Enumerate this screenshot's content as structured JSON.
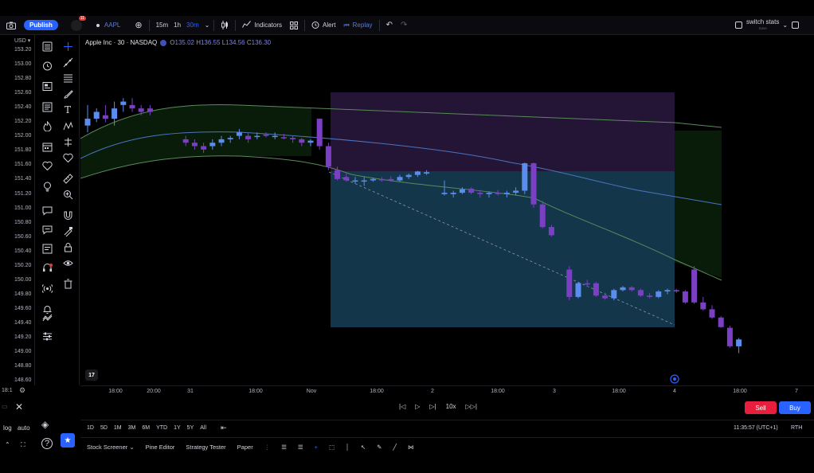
{
  "toolbar": {
    "publish_label": "Publish",
    "notif_count": "11",
    "symbol": "AAPL",
    "timeframes": [
      "15m",
      "1h",
      "30m"
    ],
    "indicators_label": "Indicators",
    "alert_label": "Alert",
    "replay_label": "Replay",
    "layout_name": "switch stats",
    "layout_sub": "Save"
  },
  "legend": {
    "title": "Apple Inc · 30 · NASDAQ",
    "o_label": "O",
    "o": "135.02",
    "h_label": "H",
    "h": "136.55",
    "l_label": "L",
    "l": "134.56",
    "c_label": "C",
    "c": "136.30"
  },
  "price_scale": {
    "currency": "USD",
    "labels": [
      "153.20",
      "153.00",
      "152.80",
      "152.60",
      "152.40",
      "152.20",
      "152.00",
      "151.80",
      "151.60",
      "151.40",
      "151.20",
      "151.00",
      "150.80",
      "150.60",
      "150.40",
      "150.20",
      "150.00",
      "149.80",
      "149.60",
      "149.40",
      "149.20",
      "149.00",
      "148.80",
      "148.60"
    ]
  },
  "time_axis": {
    "labels": [
      "18:00",
      "20:00",
      "31",
      "18:00",
      "Nov",
      "18:00",
      "2",
      "18:00",
      "3",
      "18:00",
      "4",
      "18:00",
      "7"
    ]
  },
  "replay": {
    "speed": "10x",
    "sell_label": "Sell",
    "buy_label": "Buy"
  },
  "range_bar": {
    "ranges": [
      "1D",
      "5D",
      "1M",
      "3M",
      "6M",
      "YTD",
      "1Y",
      "5Y",
      "All"
    ],
    "clock": "11:35:57 (UTC+1)",
    "session": "RTH",
    "log_label": "log",
    "auto_label": "auto",
    "corner_label": "18:1"
  },
  "bottom_panel": {
    "tabs": [
      "Stock Screener",
      "Pine Editor",
      "Strategy Tester",
      "Paper"
    ]
  },
  "colors": {
    "bull": "#5b8def",
    "bear": "#7b3fc4",
    "accent": "#2962ff",
    "sell": "#e91e3c"
  },
  "chart_data": {
    "type": "candlestick",
    "title": "Apple Inc · 30 · NASDAQ",
    "ylim": [
      148.5,
      153.3
    ],
    "candles": [
      {
        "x": 0,
        "o": 152.1,
        "h": 152.4,
        "l": 152.0,
        "c": 152.2
      },
      {
        "x": 1,
        "o": 152.2,
        "h": 152.35,
        "l": 152.15,
        "c": 152.3
      },
      {
        "x": 2,
        "o": 152.25,
        "h": 152.4,
        "l": 152.15,
        "c": 152.2
      },
      {
        "x": 3,
        "o": 152.2,
        "h": 152.45,
        "l": 152.1,
        "c": 152.35
      },
      {
        "x": 4,
        "o": 152.4,
        "h": 152.5,
        "l": 152.3,
        "c": 152.45
      },
      {
        "x": 5,
        "o": 152.4,
        "h": 152.5,
        "l": 152.3,
        "c": 152.35
      },
      {
        "x": 6,
        "o": 152.35,
        "h": 152.4,
        "l": 152.25,
        "c": 152.3
      },
      {
        "x": 7,
        "o": 152.35,
        "h": 152.4,
        "l": 152.25,
        "c": 152.3
      },
      {
        "x": 11,
        "o": 151.9,
        "h": 151.95,
        "l": 151.8,
        "c": 151.85
      },
      {
        "x": 12,
        "o": 151.85,
        "h": 151.9,
        "l": 151.75,
        "c": 151.8
      },
      {
        "x": 13,
        "o": 151.8,
        "h": 151.85,
        "l": 151.7,
        "c": 151.75
      },
      {
        "x": 14,
        "o": 151.8,
        "h": 151.9,
        "l": 151.75,
        "c": 151.85
      },
      {
        "x": 15,
        "o": 151.85,
        "h": 151.95,
        "l": 151.8,
        "c": 151.9
      },
      {
        "x": 16,
        "o": 151.9,
        "h": 151.95,
        "l": 151.85,
        "c": 151.92
      },
      {
        "x": 17,
        "o": 151.95,
        "h": 152.05,
        "l": 151.9,
        "c": 152.0
      },
      {
        "x": 18,
        "o": 151.95,
        "h": 152.0,
        "l": 151.85,
        "c": 151.9
      },
      {
        "x": 19,
        "o": 151.95,
        "h": 152.0,
        "l": 151.9,
        "c": 151.95
      },
      {
        "x": 20,
        "o": 151.97,
        "h": 152.0,
        "l": 151.93,
        "c": 151.95
      },
      {
        "x": 21,
        "o": 151.95,
        "h": 152.0,
        "l": 151.9,
        "c": 151.95
      },
      {
        "x": 22,
        "o": 151.93,
        "h": 151.98,
        "l": 151.9,
        "c": 151.92
      },
      {
        "x": 23,
        "o": 151.92,
        "h": 151.95,
        "l": 151.85,
        "c": 151.9
      },
      {
        "x": 24,
        "o": 151.9,
        "h": 151.92,
        "l": 151.8,
        "c": 151.85
      },
      {
        "x": 25,
        "o": 151.85,
        "h": 151.9,
        "l": 151.8,
        "c": 151.88
      },
      {
        "x": 26,
        "o": 152.2,
        "h": 152.2,
        "l": 151.75,
        "c": 151.8
      },
      {
        "x": 27,
        "o": 151.8,
        "h": 151.85,
        "l": 151.45,
        "c": 151.5
      },
      {
        "x": 28,
        "o": 151.45,
        "h": 151.5,
        "l": 151.3,
        "c": 151.32
      },
      {
        "x": 29,
        "o": 151.35,
        "h": 151.4,
        "l": 151.28,
        "c": 151.3
      },
      {
        "x": 30,
        "o": 151.3,
        "h": 151.35,
        "l": 151.25,
        "c": 151.3
      },
      {
        "x": 31,
        "o": 151.3,
        "h": 151.35,
        "l": 151.22,
        "c": 151.3
      },
      {
        "x": 32,
        "o": 151.3,
        "h": 151.34,
        "l": 151.28,
        "c": 151.32
      },
      {
        "x": 33,
        "o": 151.32,
        "h": 151.35,
        "l": 151.28,
        "c": 151.3
      },
      {
        "x": 34,
        "o": 151.32,
        "h": 151.36,
        "l": 151.28,
        "c": 151.3
      },
      {
        "x": 35,
        "o": 151.3,
        "h": 151.38,
        "l": 151.28,
        "c": 151.35
      },
      {
        "x": 36,
        "o": 151.35,
        "h": 151.4,
        "l": 151.32,
        "c": 151.38
      },
      {
        "x": 37,
        "o": 151.38,
        "h": 151.44,
        "l": 151.35,
        "c": 151.43
      },
      {
        "x": 38,
        "o": 151.4,
        "h": 151.45,
        "l": 151.38,
        "c": 151.42
      },
      {
        "x": 40,
        "o": 151.1,
        "h": 151.3,
        "l": 151.08,
        "c": 151.12
      },
      {
        "x": 41,
        "o": 151.1,
        "h": 151.15,
        "l": 151.05,
        "c": 151.12
      },
      {
        "x": 42,
        "o": 151.12,
        "h": 151.2,
        "l": 151.1,
        "c": 151.17
      },
      {
        "x": 43,
        "o": 151.18,
        "h": 151.2,
        "l": 151.1,
        "c": 151.12
      },
      {
        "x": 44,
        "o": 151.12,
        "h": 151.16,
        "l": 151.05,
        "c": 151.1
      },
      {
        "x": 45,
        "o": 151.1,
        "h": 151.14,
        "l": 151.05,
        "c": 151.12
      },
      {
        "x": 46,
        "o": 151.12,
        "h": 151.16,
        "l": 151.08,
        "c": 151.1
      },
      {
        "x": 47,
        "o": 151.1,
        "h": 151.15,
        "l": 151.05,
        "c": 151.12
      },
      {
        "x": 48,
        "o": 151.12,
        "h": 151.2,
        "l": 151.08,
        "c": 151.15
      },
      {
        "x": 49,
        "o": 151.15,
        "h": 151.56,
        "l": 151.1,
        "c": 151.55
      },
      {
        "x": 50,
        "o": 151.55,
        "h": 151.56,
        "l": 150.9,
        "c": 150.95
      },
      {
        "x": 51,
        "o": 150.95,
        "h": 151.0,
        "l": 150.6,
        "c": 150.62
      },
      {
        "x": 52,
        "o": 150.62,
        "h": 150.65,
        "l": 150.48,
        "c": 150.5
      },
      {
        "x": 54,
        "o": 150.0,
        "h": 150.05,
        "l": 149.55,
        "c": 149.6
      },
      {
        "x": 55,
        "o": 149.6,
        "h": 149.82,
        "l": 149.58,
        "c": 149.8
      },
      {
        "x": 56,
        "o": 149.8,
        "h": 149.85,
        "l": 149.75,
        "c": 149.78
      },
      {
        "x": 57,
        "o": 149.8,
        "h": 149.82,
        "l": 149.6,
        "c": 149.62
      },
      {
        "x": 58,
        "o": 149.62,
        "h": 149.66,
        "l": 149.56,
        "c": 149.58
      },
      {
        "x": 59,
        "o": 149.58,
        "h": 149.72,
        "l": 149.55,
        "c": 149.7
      },
      {
        "x": 60,
        "o": 149.7,
        "h": 149.76,
        "l": 149.68,
        "c": 149.74
      },
      {
        "x": 61,
        "o": 149.74,
        "h": 149.76,
        "l": 149.68,
        "c": 149.7
      },
      {
        "x": 62,
        "o": 149.7,
        "h": 149.72,
        "l": 149.6,
        "c": 149.62
      },
      {
        "x": 63,
        "o": 149.62,
        "h": 149.66,
        "l": 149.58,
        "c": 149.6
      },
      {
        "x": 64,
        "o": 149.6,
        "h": 149.7,
        "l": 149.58,
        "c": 149.68
      },
      {
        "x": 65,
        "o": 149.68,
        "h": 149.72,
        "l": 149.64,
        "c": 149.7
      },
      {
        "x": 66,
        "o": 149.7,
        "h": 149.72,
        "l": 149.66,
        "c": 149.68
      },
      {
        "x": 67,
        "o": 149.68,
        "h": 149.7,
        "l": 149.5,
        "c": 149.52
      },
      {
        "x": 68,
        "o": 150.0,
        "h": 150.05,
        "l": 149.5,
        "c": 149.52
      },
      {
        "x": 69,
        "o": 149.52,
        "h": 149.6,
        "l": 149.4,
        "c": 149.42
      },
      {
        "x": 70,
        "o": 149.42,
        "h": 149.48,
        "l": 149.28,
        "c": 149.3
      },
      {
        "x": 71,
        "o": 149.3,
        "h": 149.32,
        "l": 149.15,
        "c": 149.16
      },
      {
        "x": 72,
        "o": 149.15,
        "h": 149.18,
        "l": 148.86,
        "c": 148.88
      },
      {
        "x": 73,
        "o": 148.88,
        "h": 149.0,
        "l": 148.78,
        "c": 148.98
      }
    ]
  }
}
